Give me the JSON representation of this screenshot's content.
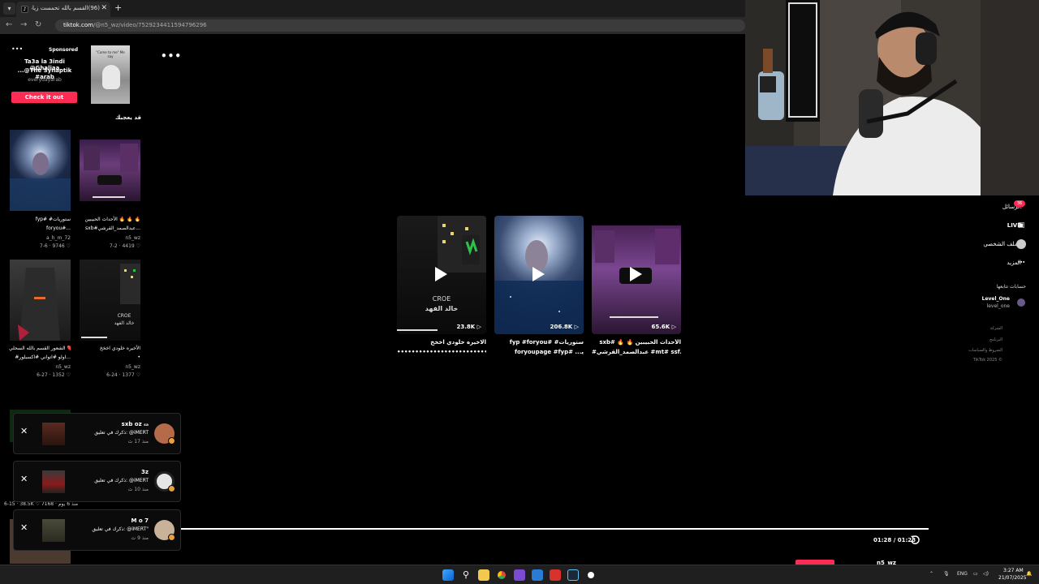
{
  "browser": {
    "tab_title": "(96)القسم بالله تحمست زيادة من",
    "url_host": "tiktok.com",
    "url_path": "/@n5_wz/video/7529234411594796296"
  },
  "ad": {
    "sponsored_label": "Sponsored",
    "title_line1": "Ta3a la 3indi @Ghaliaa",
    "title_line2": "...@The Synaptik #arab",
    "account": "everydayarab",
    "cta": "Check it out",
    "thumb_caption": "\"Come to me\" Me say"
  },
  "you_may_like": {
    "heading": "قد يعجبك",
    "items": [
      {
        "title1": "fyp# #ستوريات",
        "title2": "foryou#...",
        "author": "a_h_m_72",
        "meta": "7-6 · 9746 ♡"
      },
      {
        "title1": "الأحداث الحبيبين 🔥 🔥 🔥",
        "title2": "sxb#عبدالصمد_القرشي...",
        "author": "n5_wz",
        "meta": "7-2 · 4419 ♡"
      },
      {
        "title1": "الشعور القسم بالله السحلي ❤️",
        "title2": "#اولو #اتواني #اكسبلور...",
        "author": "n5_wz",
        "meta": "6-27 · 1352 ♡"
      },
      {
        "title1": "الأخيره خلودي اخخخ",
        "title2": "•",
        "author": "n5_wz",
        "meta": "6-24 · 1377 ♡"
      }
    ]
  },
  "thumb_texts": {
    "croe": "CROE",
    "khaled": "خالد الفهد"
  },
  "notifications": [
    {
      "user": "sxb oz ₛₐ",
      "text": "ذكرك في تعليق: @iMERT",
      "time": "منذ 17 ث"
    },
    {
      "user": "3z",
      "text": "ذكرك في تعليق: @iMERT",
      "time": "منذ 10 ث"
    },
    {
      "user": "M o 7",
      "text": "ذكرك في تعليق: @iMERT\"",
      "time": "منذ 9 ث"
    }
  ],
  "leak_meta": "6-15 · 38.5K ♡ 7168 · منذ 6 يوم",
  "videos": [
    {
      "count": "23.8K",
      "cap1": "الاخيره خلودي اخخخ",
      "cap2": "•••••••••••••••••••••••••"
    },
    {
      "count": "206.8K",
      "cap1": "fyp #foryou# #ستوريات",
      "cap2": "foryoupage #fyp# ...ﯾ"
    },
    {
      "count": "65.6K",
      "cap1": "sxb# 🔥 🔥 الأحداث الحبيبين",
      "cap2": "#عبدالصمد_القرشي #mt# ssf..."
    }
  ],
  "player": {
    "time": "01:28 / 01:28",
    "bottom_user": "n5_wz"
  },
  "right_nav": {
    "messages": "الرسائل",
    "messages_badge": "36",
    "live": "LIVE",
    "profile": "الملف الشخصي",
    "more": "المزيد",
    "following_heading": "حسابات تتابعها",
    "follow_name": "Level_One",
    "follow_handle": "level_one",
    "footer": [
      "الشركة",
      "البرنامج",
      "الشروط والسياسات",
      "TikTok 2025 ©"
    ]
  },
  "taskbar": {
    "lang": "ENG",
    "time": "3:27 AM",
    "date": "21/07/2025"
  },
  "colors": {
    "accent": "#fe2c55",
    "background": "#000000"
  }
}
